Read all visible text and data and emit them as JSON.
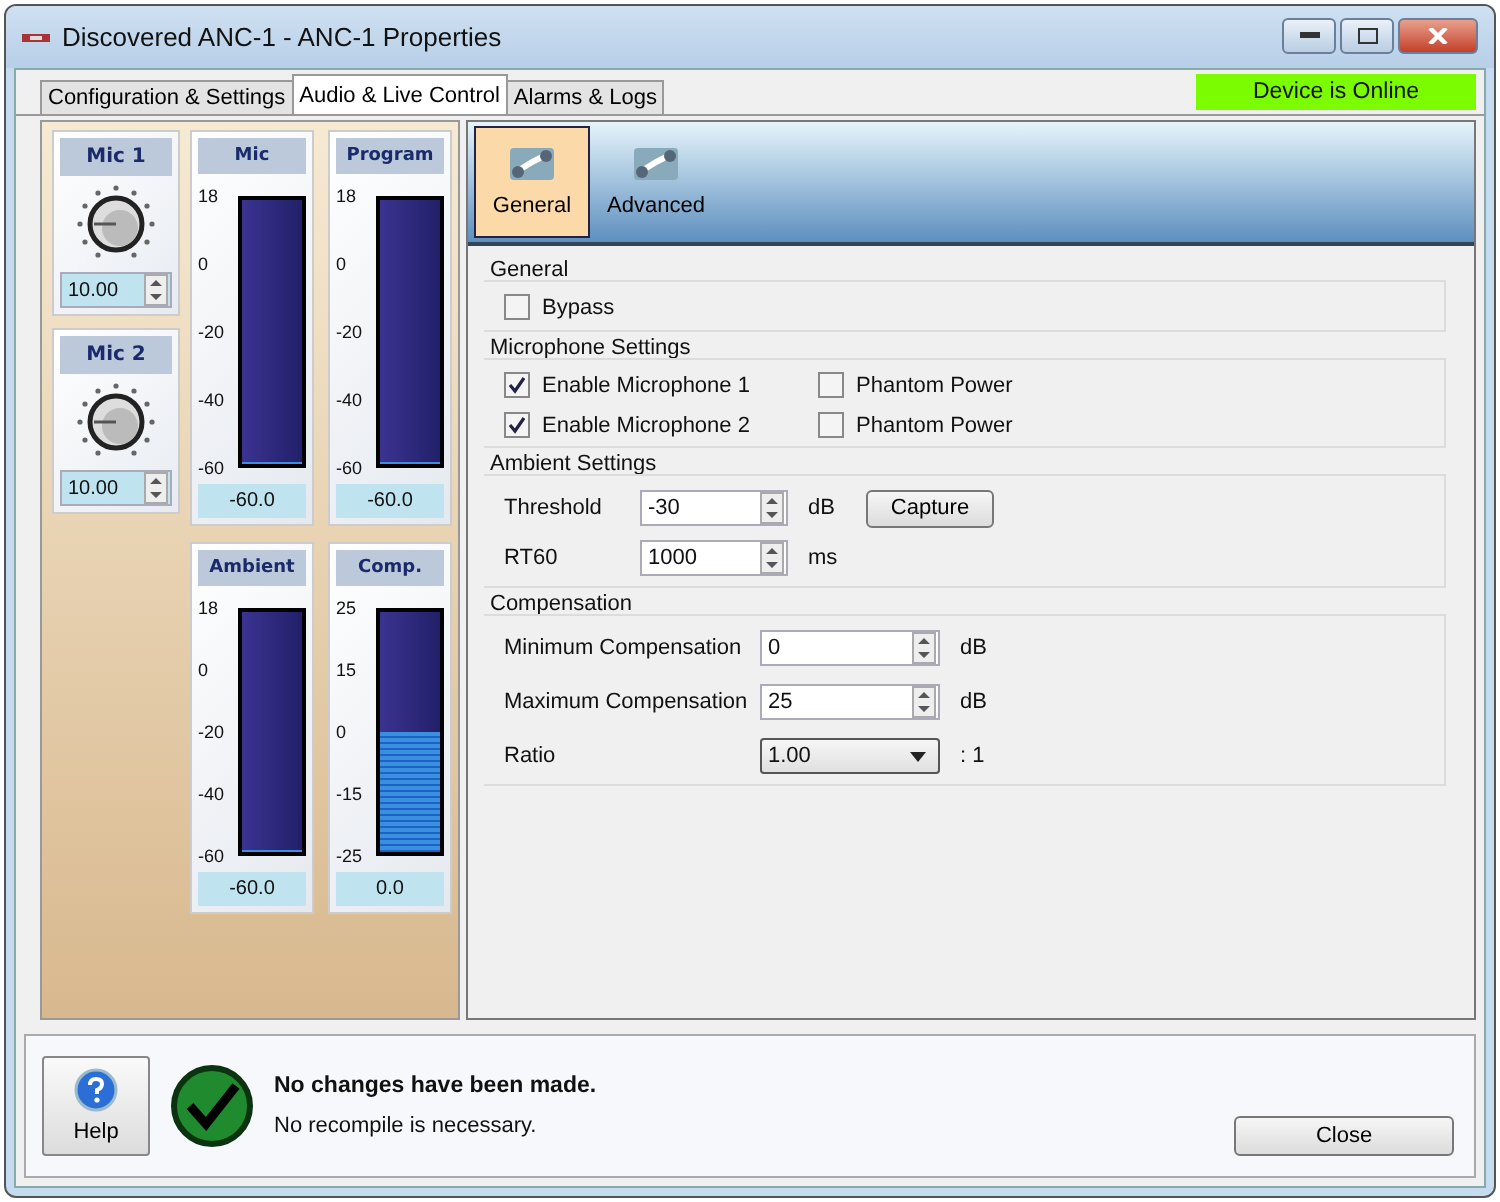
{
  "window": {
    "title": "Discovered ANC-1 - ANC-1 Properties"
  },
  "tabs": [
    {
      "label": "Configuration & Settings",
      "selected": false
    },
    {
      "label": "Audio & Live Control",
      "selected": true
    },
    {
      "label": "Alarms & Logs",
      "selected": false
    }
  ],
  "status_badge": "Device is Online",
  "mic_inputs": [
    {
      "label": "Mic 1",
      "value": "10.00"
    },
    {
      "label": "Mic 2",
      "value": "10.00"
    }
  ],
  "meters": [
    {
      "label": "Mic",
      "ticks": [
        "18",
        "0",
        "-20",
        "-40",
        "-60"
      ],
      "reading": "-60.0",
      "level": 0
    },
    {
      "label": "Program",
      "ticks": [
        "18",
        "0",
        "-20",
        "-40",
        "-60"
      ],
      "reading": "-60.0",
      "level": 0
    },
    {
      "label": "Ambient",
      "ticks": [
        "18",
        "0",
        "-20",
        "-40",
        "-60"
      ],
      "reading": "-60.0",
      "level": 0
    },
    {
      "label": "Comp.",
      "ticks": [
        "25",
        "15",
        "0",
        "-15",
        "-25"
      ],
      "reading": "0.0",
      "level": 0.5
    }
  ],
  "settings_tabs": [
    {
      "label": "General",
      "selected": true
    },
    {
      "label": "Advanced",
      "selected": false
    }
  ],
  "general": {
    "title": "General",
    "bypass": {
      "label": "Bypass",
      "checked": false
    }
  },
  "microphone": {
    "title": "Microphone Settings",
    "rows": [
      {
        "enable": {
          "label": "Enable Microphone 1",
          "checked": true
        },
        "phantom": {
          "label": "Phantom Power",
          "checked": false
        }
      },
      {
        "enable": {
          "label": "Enable Microphone 2",
          "checked": true
        },
        "phantom": {
          "label": "Phantom Power",
          "checked": false
        }
      }
    ]
  },
  "ambient": {
    "title": "Ambient Settings",
    "capture_button": "Capture",
    "fields": [
      {
        "label": "Threshold",
        "value": "-30",
        "unit": "dB"
      },
      {
        "label": "RT60",
        "value": "1000",
        "unit": "ms"
      }
    ]
  },
  "compensation": {
    "title": "Compensation",
    "fields": [
      {
        "kind": "spin",
        "label": "Minimum Compensation",
        "value": "0",
        "unit": "dB"
      },
      {
        "kind": "spin",
        "label": "Maximum Compensation",
        "value": "25",
        "unit": "dB"
      },
      {
        "kind": "dropdown",
        "label": "Ratio",
        "value": "1.00",
        "unit": ": 1"
      }
    ]
  },
  "footer": {
    "help_button": "Help",
    "message": "No changes have been made.",
    "detail": "No recompile is necessary.",
    "close_button": "Close"
  }
}
